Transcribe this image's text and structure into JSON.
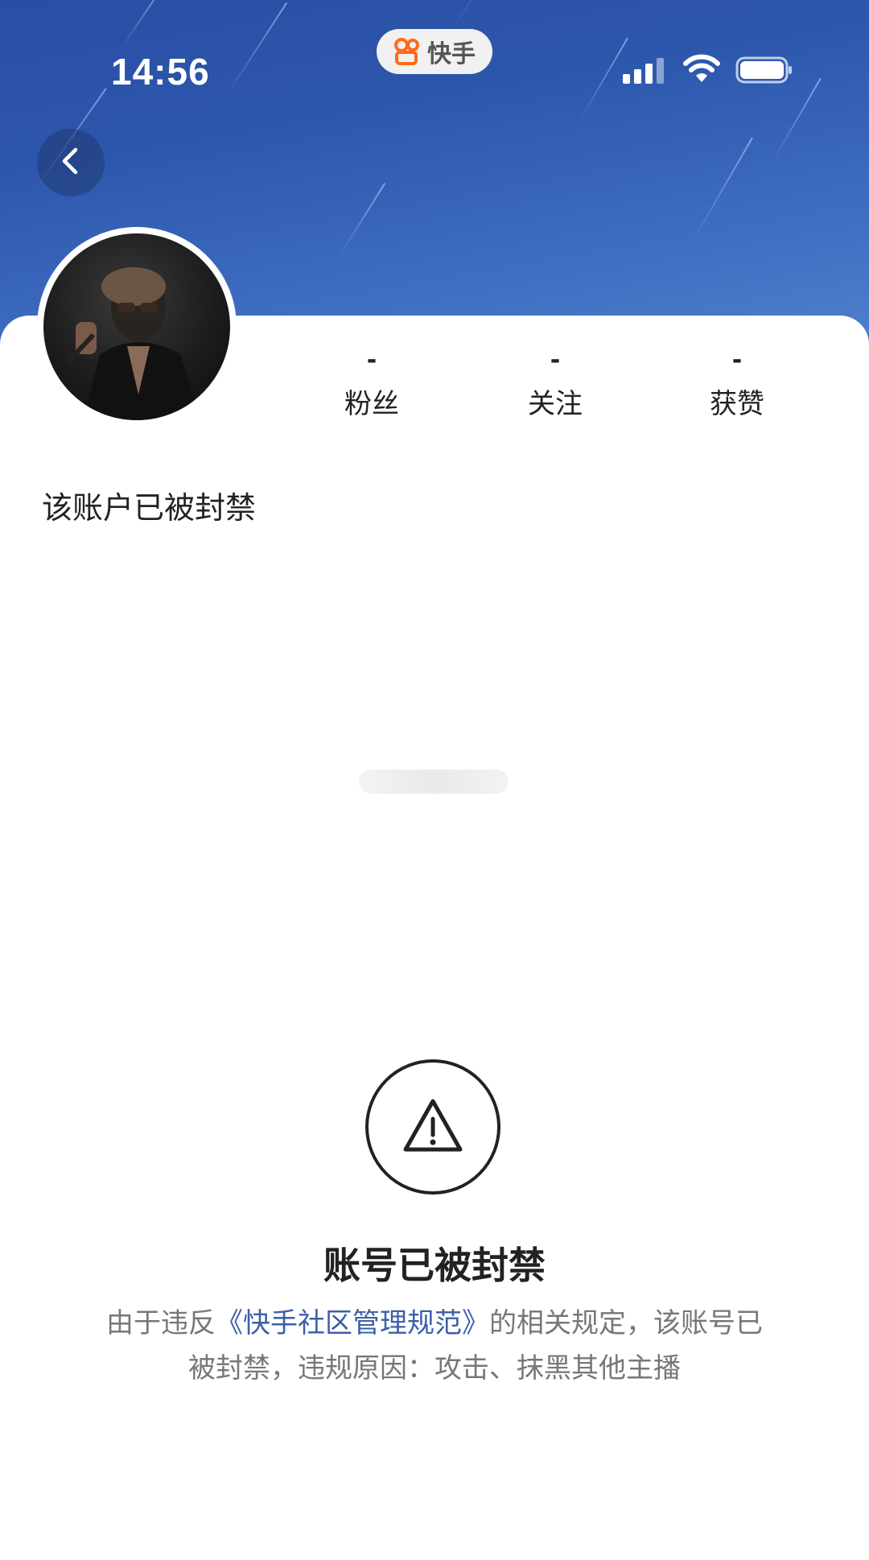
{
  "status_bar": {
    "time": "14:56",
    "app_name": "快手"
  },
  "profile": {
    "stats": [
      {
        "value": "-",
        "label": "粉丝"
      },
      {
        "value": "-",
        "label": "关注"
      },
      {
        "value": "-",
        "label": "获赞"
      }
    ],
    "status_note": "该账户已被封禁"
  },
  "ban_notice": {
    "title": "账号已被封禁",
    "desc_prefix": "由于违反",
    "desc_link": "《快手社区管理规范》",
    "desc_suffix": "的相关规定，该账号已被封禁，违规原因：攻击、抹黑其他主播"
  },
  "colors": {
    "banner": "#2c57ad",
    "link": "#3d5fa8",
    "app_logo": "#ff6a1a"
  },
  "icons": {
    "back": "chevron-left-icon",
    "warning": "warning-triangle-icon",
    "signal": "cellular-signal-icon",
    "wifi": "wifi-icon",
    "battery": "battery-icon",
    "app_logo": "kuaishou-logo-icon"
  }
}
